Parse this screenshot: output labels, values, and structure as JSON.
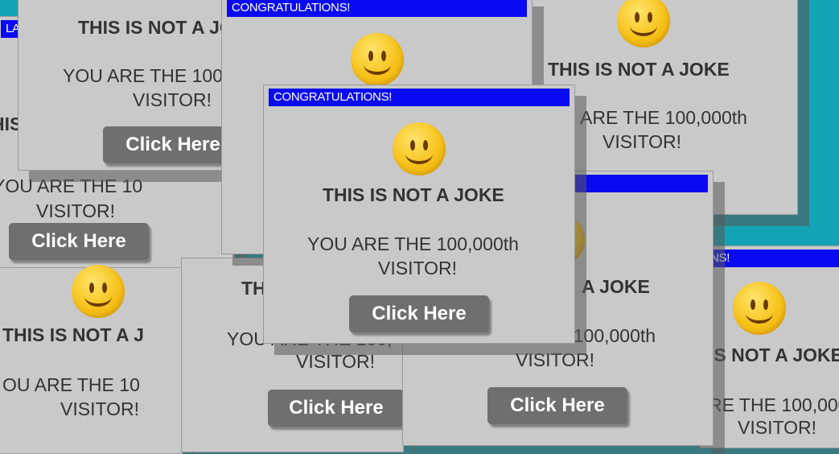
{
  "popup": {
    "title": "CONGRATULATIONS!",
    "title_partial_left": "LA",
    "title_partial_right": "NS!",
    "heading": "THIS IS NOT A JOKE",
    "heading_crop_a": "THIS IS NOT A J",
    "heading_crop_b": "THIS IS NOT A",
    "heading_crop_c": "IS NOT A JOKE",
    "heading_crop_d": "A JOKE",
    "heading_crop_e": "THIS IS NOT A JOK",
    "heading_crop_f": "TH",
    "heading_crop_g": "THIS",
    "message_line1": "YOU ARE THE 100,000th",
    "message_line2": "VISITOR!",
    "message_line1_crop_a": "YOU ARE THE 10",
    "message_line1_crop_b": "ARE THE 100,000th",
    "message_line1_crop_c": "E 100,000th",
    "message_line1_crop_d": "YOU ARE THE 100,",
    "message_line1_crop_e": "OU ARE THE 10",
    "message_line1_crop_f": "RE THE 100,000",
    "button_label": "Click Here"
  },
  "colors": {
    "background": "#12a3b4",
    "window": "#c9c9c9",
    "titlebar": "#0a0af2",
    "button": "#6f6f6f",
    "smiley": "#f6c21a"
  },
  "icons": {
    "smiley": "smiley-face-icon"
  }
}
